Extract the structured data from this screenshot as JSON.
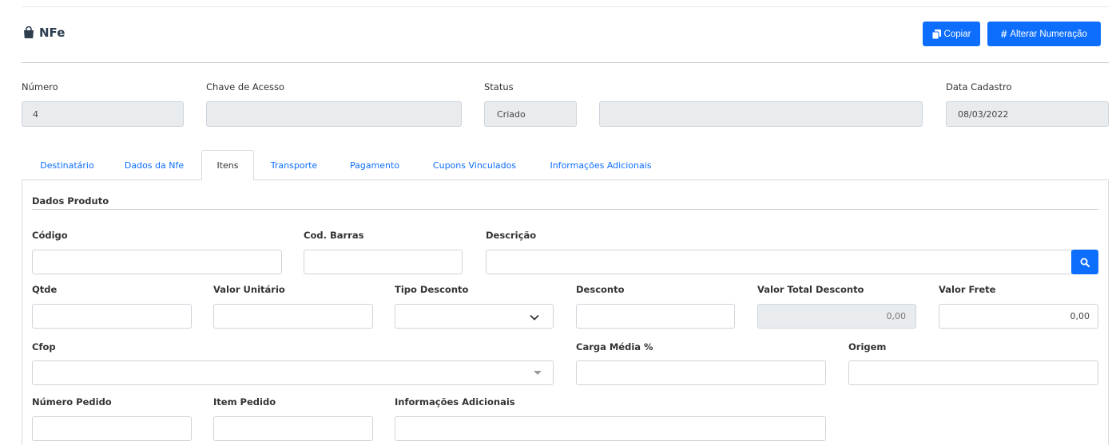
{
  "header": {
    "title": "NFe",
    "copy_label": "Copiar",
    "renumber_label": "Alterar Numeração"
  },
  "info": {
    "numero_label": "Número",
    "numero_value": "4",
    "chave_label": "Chave de Acesso",
    "chave_value": "",
    "status_label": "Status",
    "status_value": "Criado",
    "status_detail_value": "",
    "data_label": "Data Cadastro",
    "data_value": "08/03/2022"
  },
  "tabs": [
    {
      "label": "Destinatário",
      "active": false
    },
    {
      "label": "Dados da Nfe",
      "active": false
    },
    {
      "label": "Itens",
      "active": true
    },
    {
      "label": "Transporte",
      "active": false
    },
    {
      "label": "Pagamento",
      "active": false
    },
    {
      "label": "Cupons Vinculados",
      "active": false
    },
    {
      "label": "Informações Adicionais",
      "active": false
    }
  ],
  "section": {
    "title": "Dados Produto"
  },
  "form": {
    "codigo_label": "Código",
    "cod_barras_label": "Cod. Barras",
    "descricao_label": "Descrição",
    "qtde_label": "Qtde",
    "valor_unitario_label": "Valor Unitário",
    "tipo_desconto_label": "Tipo Desconto",
    "desconto_label": "Desconto",
    "valor_total_desconto_label": "Valor Total Desconto",
    "valor_total_desconto_value": "0,00",
    "valor_frete_label": "Valor Frete",
    "valor_frete_value": "0,00",
    "cfop_label": "Cfop",
    "carga_media_label": "Carga Média %",
    "origem_label": "Origem",
    "numero_pedido_label": "Número Pedido",
    "item_pedido_label": "Item Pedido",
    "info_adicionais_label": "Informações Adicionais"
  },
  "colors": {
    "primary": "#0d6efd",
    "readonly_bg": "#e9ecef",
    "border": "#ced4da"
  },
  "icons": {
    "title": "shopping-bag-icon",
    "copy": "copy-icon",
    "renumber": "hash-icon",
    "search": "search-icon",
    "chevron": "chevron-down-icon",
    "caret": "caret-down-icon"
  }
}
